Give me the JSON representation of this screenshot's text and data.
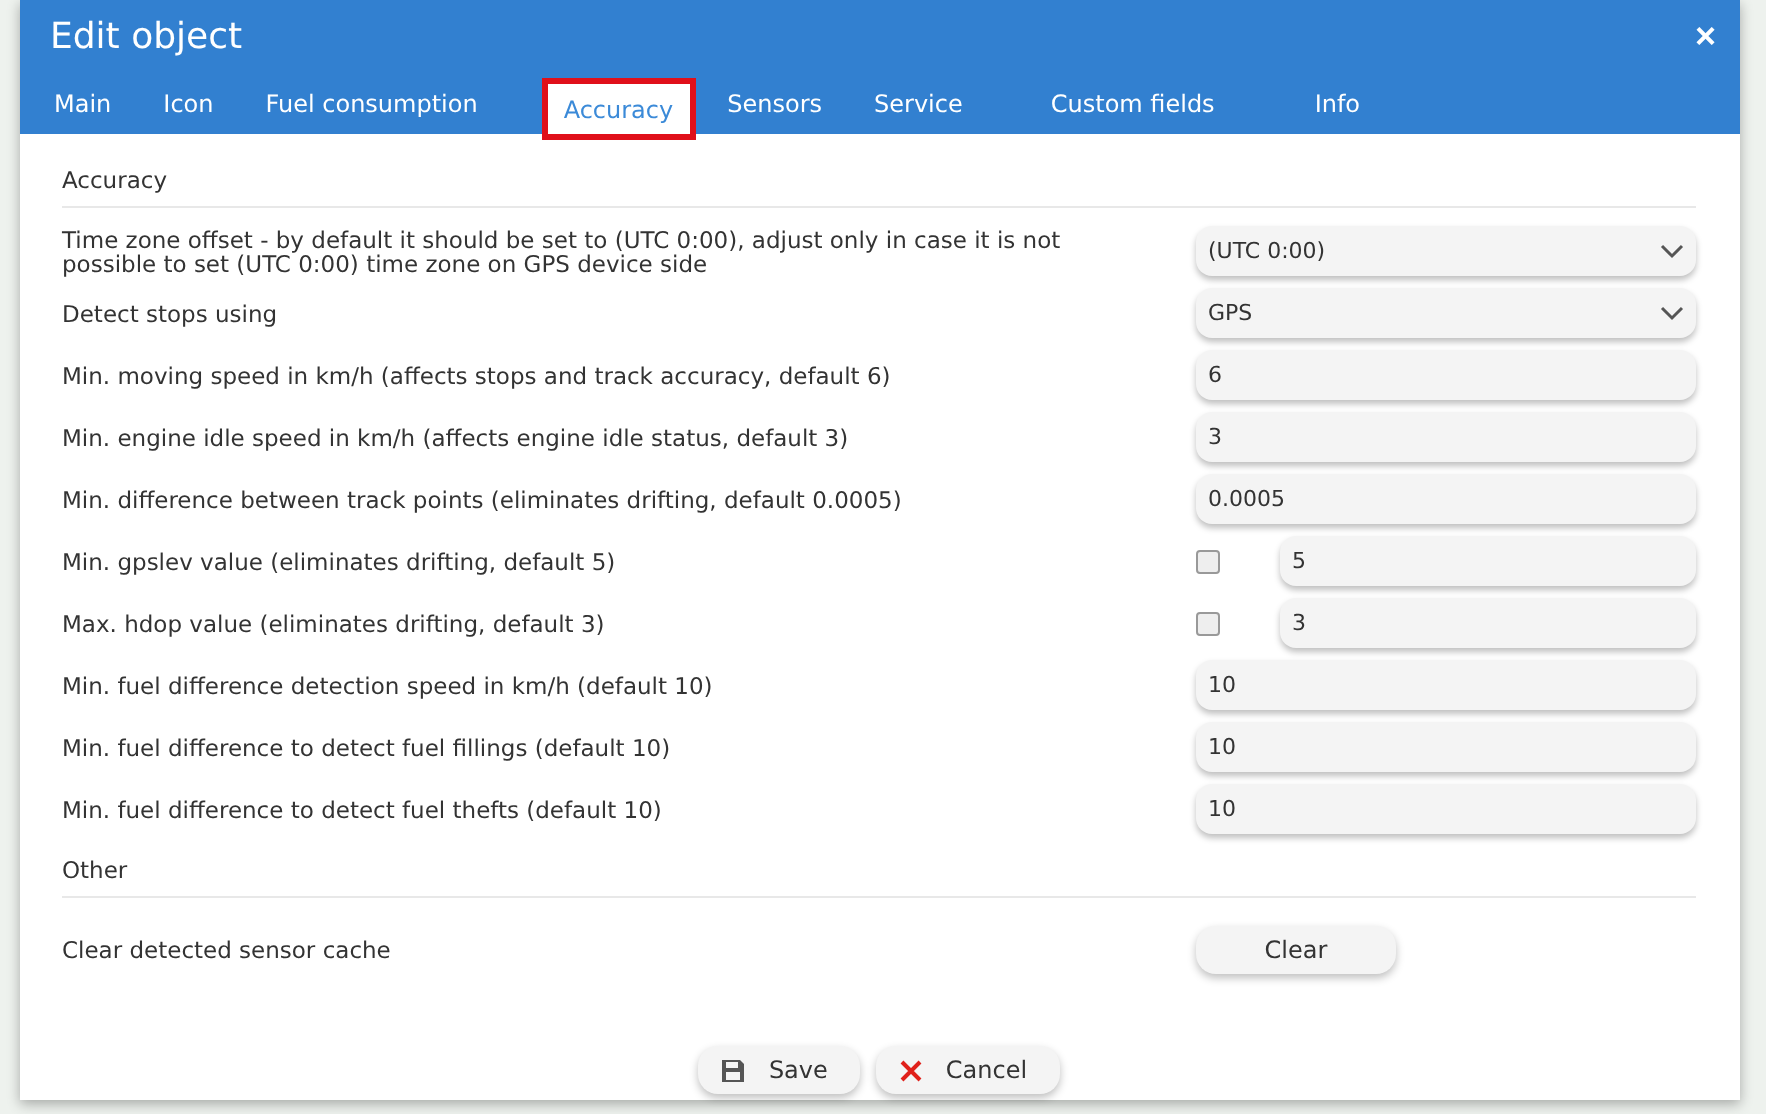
{
  "window": {
    "title": "Edit object",
    "close": "×"
  },
  "tabs": [
    {
      "label": "Main",
      "selected": false,
      "highlighted": false
    },
    {
      "label": "Icon",
      "selected": false,
      "highlighted": false
    },
    {
      "label": "Fuel consumption",
      "selected": false,
      "highlighted": false
    },
    {
      "label": "Accuracy",
      "selected": true,
      "highlighted": true
    },
    {
      "label": "Sensors",
      "selected": false,
      "highlighted": false
    },
    {
      "label": "Service",
      "selected": false,
      "highlighted": false
    },
    {
      "label": "Custom fields",
      "selected": false,
      "highlighted": false
    },
    {
      "label": "Info",
      "selected": false,
      "highlighted": false
    }
  ],
  "sections": [
    {
      "title": "Accuracy",
      "rows": [
        {
          "kind": "select",
          "label": "Time zone offset - by default it should be set to (UTC 0:00), adjust only in case it is not possible to set (UTC 0:00) time zone on GPS device side",
          "value": "(UTC 0:00)"
        },
        {
          "kind": "select",
          "label": "Detect stops using",
          "value": "GPS"
        },
        {
          "kind": "text",
          "label": "Min. moving speed in km/h (affects stops and track accuracy, default 6)",
          "value": "6"
        },
        {
          "kind": "text",
          "label": "Min. engine idle speed in km/h (affects engine idle status, default 3)",
          "value": "3"
        },
        {
          "kind": "text",
          "label": "Min. difference between track points (eliminates drifting, default 0.0005)",
          "value": "0.0005"
        },
        {
          "kind": "check_text",
          "label": "Min. gpslev value (eliminates drifting, default 5)",
          "checked": false,
          "value": "5"
        },
        {
          "kind": "check_text",
          "label": "Max. hdop value (eliminates drifting, default 3)",
          "checked": false,
          "value": "3"
        },
        {
          "kind": "text",
          "label": "Min. fuel difference detection speed in km/h (default 10)",
          "value": "10"
        },
        {
          "kind": "text",
          "label": "Min. fuel difference to detect fuel fillings (default 10)",
          "value": "10"
        },
        {
          "kind": "text",
          "label": "Min. fuel difference to detect fuel thefts (default 10)",
          "value": "10"
        }
      ]
    },
    {
      "title": "Other",
      "rows": [
        {
          "kind": "button",
          "label": "Clear detected sensor cache",
          "value": "Clear"
        }
      ]
    }
  ],
  "buttons": [
    {
      "kind": "save",
      "label": "Save"
    },
    {
      "kind": "cancel",
      "label": "Cancel"
    }
  ]
}
